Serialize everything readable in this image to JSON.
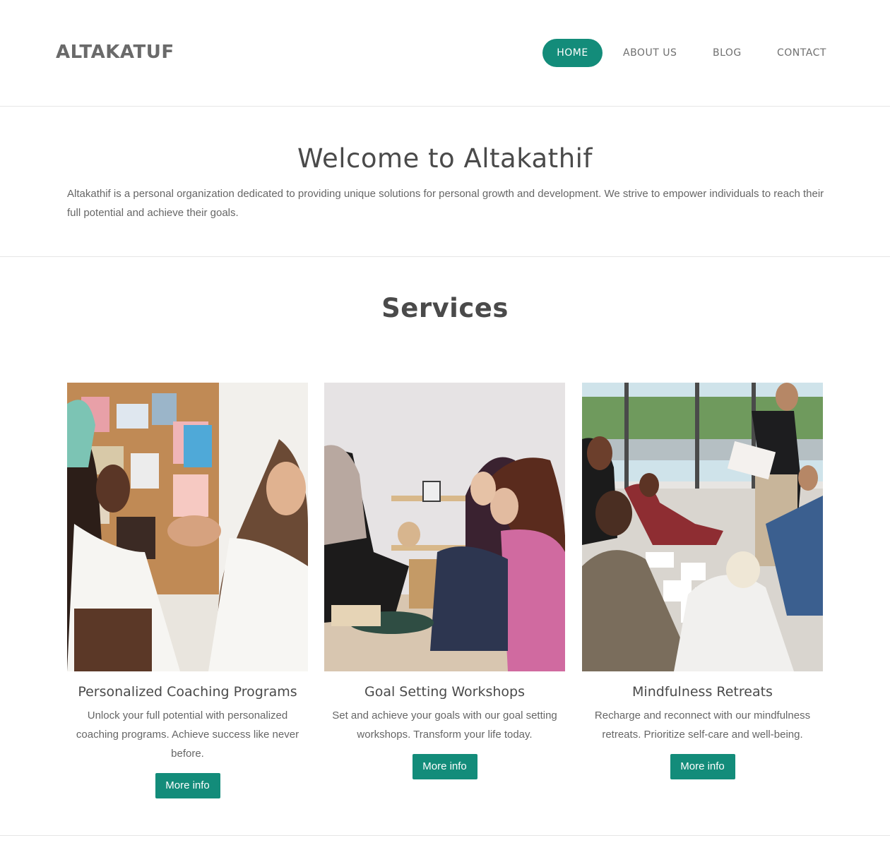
{
  "header": {
    "brand": "ALTAKATUF",
    "nav": [
      {
        "label": "HOME",
        "active": true
      },
      {
        "label": "ABOUT US"
      },
      {
        "label": "BLOG"
      },
      {
        "label": "CONTACT"
      }
    ]
  },
  "welcome": {
    "title": "Welcome to Altakathif",
    "body": "Altakathif is a personal organization dedicated to providing unique solutions for personal growth and development. We strive to empower individuals to reach their full potential and achieve their goals."
  },
  "services": {
    "title": "Services",
    "cards": [
      {
        "title": "Personalized Coaching Programs",
        "description": "Unlock your full potential with personalized coaching programs. Achieve success like never before.",
        "button": "More info",
        "image": "two-women-holding-hands-photo"
      },
      {
        "title": "Goal Setting Workshops",
        "description": "Set and achieve your goals with our goal setting workshops. Transform your life today.",
        "button": "More info",
        "image": "group-discussion-photo"
      },
      {
        "title": "Mindfulness Retreats",
        "description": "Recharge and reconnect with our mindfulness retreats. Prioritize self-care and well-being.",
        "button": "More info",
        "image": "group-session-on-floor-photo"
      }
    ]
  },
  "colors": {
    "accent": "#138c7a",
    "heading": "#4a4a4a",
    "text": "#666666"
  }
}
